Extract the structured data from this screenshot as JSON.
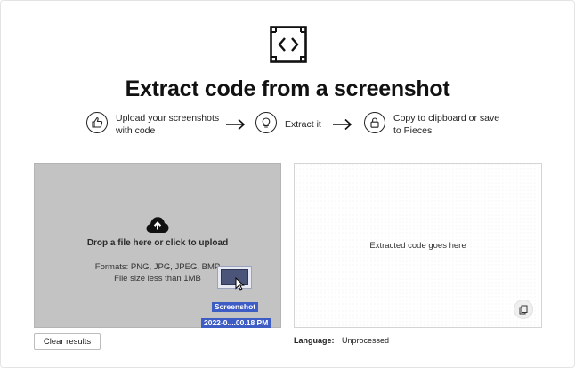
{
  "header": {
    "logo_icon": "code-brackets-icon",
    "title": "Extract code from a screenshot"
  },
  "steps": [
    {
      "icon": "thumbs-up-icon",
      "line1": "Upload your screenshots",
      "line2": "with code"
    },
    {
      "icon": "lightbulb-icon",
      "line1": "Extract it",
      "line2": ""
    },
    {
      "icon": "lock-icon",
      "line1": "Copy to clipboard or save",
      "line2": "to Pieces"
    }
  ],
  "dropzone": {
    "icon": "cloud-upload-icon",
    "label": "Drop a file here or click to upload",
    "formats": "Formats: PNG, JPG, JPEG, BMP",
    "size_limit": "File size less than 1MB",
    "drag_file_name_line1": "Screenshot",
    "drag_file_name_line2": "2022-0....00.18 PM"
  },
  "output": {
    "placeholder": "Extracted code goes here",
    "copy_icon": "copy-icon"
  },
  "footer": {
    "clear_label": "Clear results",
    "language_label": "Language:",
    "language_value": "Unprocessed"
  },
  "colors": {
    "dropzone_bg": "#c3c3c3",
    "selection_blue": "#3d5cc4",
    "text_dark": "#111111"
  }
}
